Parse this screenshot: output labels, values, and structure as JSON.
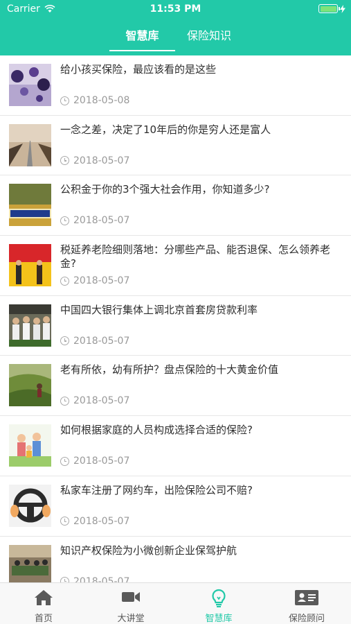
{
  "status_bar": {
    "carrier": "Carrier",
    "time": "11:53 PM"
  },
  "top_tabs": [
    {
      "label": "智慧库",
      "active": true
    },
    {
      "label": "保险知识",
      "active": false
    }
  ],
  "articles": [
    {
      "title": "给小孩买保险，最应该看的是这些",
      "date": "2018-05-08"
    },
    {
      "title": "一念之差，决定了10年后的你是穷人还是富人",
      "date": "2018-05-07"
    },
    {
      "title": "公积金于你的3个强大社会作用，你知道多少?",
      "date": "2018-05-07"
    },
    {
      "title": "税延养老险细则落地：分哪些产品、能否退保、怎么领养老金?",
      "date": "2018-05-07"
    },
    {
      "title": "中国四大银行集体上调北京首套房贷款利率",
      "date": "2018-05-07"
    },
    {
      "title": "老有所依，幼有所护？盘点保险的十大黄金价值",
      "date": "2018-05-07"
    },
    {
      "title": "如何根据家庭的人员构成选择合适的保险?",
      "date": "2018-05-07"
    },
    {
      "title": "私家车注册了网约车，出险保险公司不赔?",
      "date": "2018-05-07"
    },
    {
      "title": "知识产权保险为小微创新企业保驾护航",
      "date": "2018-05-07"
    }
  ],
  "bottom_tabs": [
    {
      "label": "首页",
      "icon": "home-icon",
      "active": false
    },
    {
      "label": "大讲堂",
      "icon": "video-camera-icon",
      "active": false
    },
    {
      "label": "智慧库",
      "icon": "lightbulb-icon",
      "active": true
    },
    {
      "label": "保险顾问",
      "icon": "id-card-icon",
      "active": false
    }
  ],
  "colors": {
    "accent": "#22c9a8",
    "text": "#2d2d2d",
    "muted": "#999999"
  }
}
